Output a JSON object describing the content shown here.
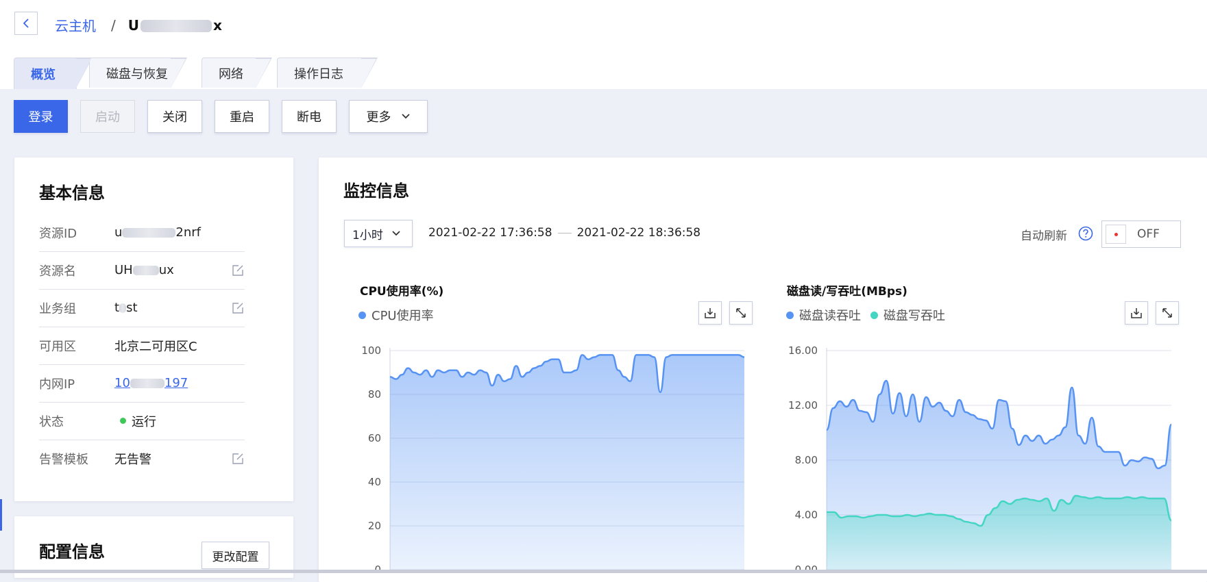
{
  "breadcrumb": {
    "parent": "云主机",
    "separator": "/",
    "current_prefix": "U",
    "current_suffix": "x"
  },
  "tabs": [
    {
      "label": "概览",
      "active": true
    },
    {
      "label": "磁盘与恢复",
      "active": false
    },
    {
      "label": "网络",
      "active": false
    },
    {
      "label": "操作日志",
      "active": false
    }
  ],
  "toolbar": {
    "login": "登录",
    "start": "启动",
    "shutdown": "关闭",
    "restart": "重启",
    "poweroff": "断电",
    "more": "更多"
  },
  "basic_info": {
    "title": "基本信息",
    "rows": [
      {
        "label": "资源ID",
        "value_prefix": "u",
        "value_suffix": "2nrf"
      },
      {
        "label": "资源名",
        "value_prefix": "UH",
        "value_suffix": "ux"
      },
      {
        "label": "业务组",
        "value_prefix": "t",
        "value_suffix": "st"
      },
      {
        "label": "可用区",
        "value": "北京二可用区C"
      },
      {
        "label": "内网IP",
        "value_prefix": "10",
        "value_suffix": "197"
      },
      {
        "label": "状态",
        "value": "运行"
      },
      {
        "label": "告警模板",
        "value": "无告警"
      }
    ]
  },
  "config_info": {
    "title": "配置信息",
    "change_button": "更改配置"
  },
  "monitor": {
    "title": "监控信息",
    "period": "1小时",
    "start_time": "2021-02-22 17:36:58",
    "end_time": "2021-02-22 18:36:58",
    "auto_refresh_label": "自动刷新",
    "toggle_state": "OFF"
  },
  "colors": {
    "accent": "#3a66e8",
    "cpu": "#5793f3",
    "disk_write": "#44d6c3",
    "status_running": "#3fc85a"
  },
  "chart_data": [
    {
      "type": "area",
      "title": "CPU使用率(%)",
      "legend": [
        "CPU使用率"
      ],
      "ylim": [
        0,
        100
      ],
      "yticks": [
        "0",
        "20",
        "40",
        "60",
        "80",
        "100"
      ],
      "grid": true,
      "series": [
        {
          "name": "CPU使用率",
          "color": "#5793f3",
          "values": [
            88,
            87,
            89,
            92,
            90,
            89,
            91,
            88,
            91,
            90,
            91,
            91,
            88,
            90,
            89,
            91,
            90,
            84,
            89,
            86,
            87,
            93,
            88,
            90,
            92,
            93,
            95,
            96,
            96,
            90,
            90,
            91,
            98,
            96,
            97,
            98,
            98,
            98,
            91,
            88,
            86,
            98,
            98,
            98,
            97,
            81,
            97,
            98,
            98,
            98,
            98,
            98,
            98,
            98,
            98,
            98,
            98,
            98,
            98,
            97
          ]
        }
      ]
    },
    {
      "type": "area",
      "title": "磁盘读/写吞吐(MBps)",
      "legend": [
        "磁盘读吞吐",
        "磁盘写吞吐"
      ],
      "ylim": [
        0,
        16
      ],
      "yticks": [
        "0.00",
        "4.00",
        "8.00",
        "12.00",
        "16.00"
      ],
      "grid": true,
      "series": [
        {
          "name": "磁盘读吞吐",
          "color": "#5793f3",
          "values": [
            10.2,
            11.8,
            12.3,
            11.9,
            12.4,
            11.6,
            11.5,
            10.8,
            12.8,
            13.8,
            11.4,
            12.9,
            11.2,
            12.8,
            10.8,
            12.6,
            11.9,
            12.2,
            11.6,
            11.2,
            12.4,
            11.5,
            11.3,
            11.0,
            10.9,
            10.3,
            12.4,
            12.3,
            10.3,
            9.1,
            9.8,
            9.4,
            9.8,
            9.2,
            9.5,
            9.8,
            10.4,
            13.3,
            9.8,
            9.2,
            11.1,
            9.0,
            8.6,
            8.6,
            8.6,
            7.6,
            8.0,
            7.9,
            8.2,
            8.1,
            7.4,
            7.6,
            10.6
          ]
        },
        {
          "name": "磁盘写吞吐",
          "color": "#44d6c3",
          "values": [
            4.2,
            4.2,
            3.8,
            3.9,
            3.9,
            3.8,
            3.9,
            4.0,
            4.0,
            3.9,
            3.9,
            4.0,
            3.9,
            4.0,
            4.1,
            4.0,
            4.0,
            3.9,
            3.7,
            3.5,
            3.4,
            3.2,
            4.0,
            4.5,
            5.0,
            4.8,
            5.1,
            5.2,
            5.1,
            5.0,
            5.2,
            4.3,
            5.1,
            4.8,
            5.4,
            5.3,
            5.2,
            5.3,
            5.2,
            5.2,
            5.2,
            5.3,
            5.2,
            5.3,
            5.2,
            5.2,
            5.2,
            3.6
          ]
        }
      ]
    }
  ]
}
